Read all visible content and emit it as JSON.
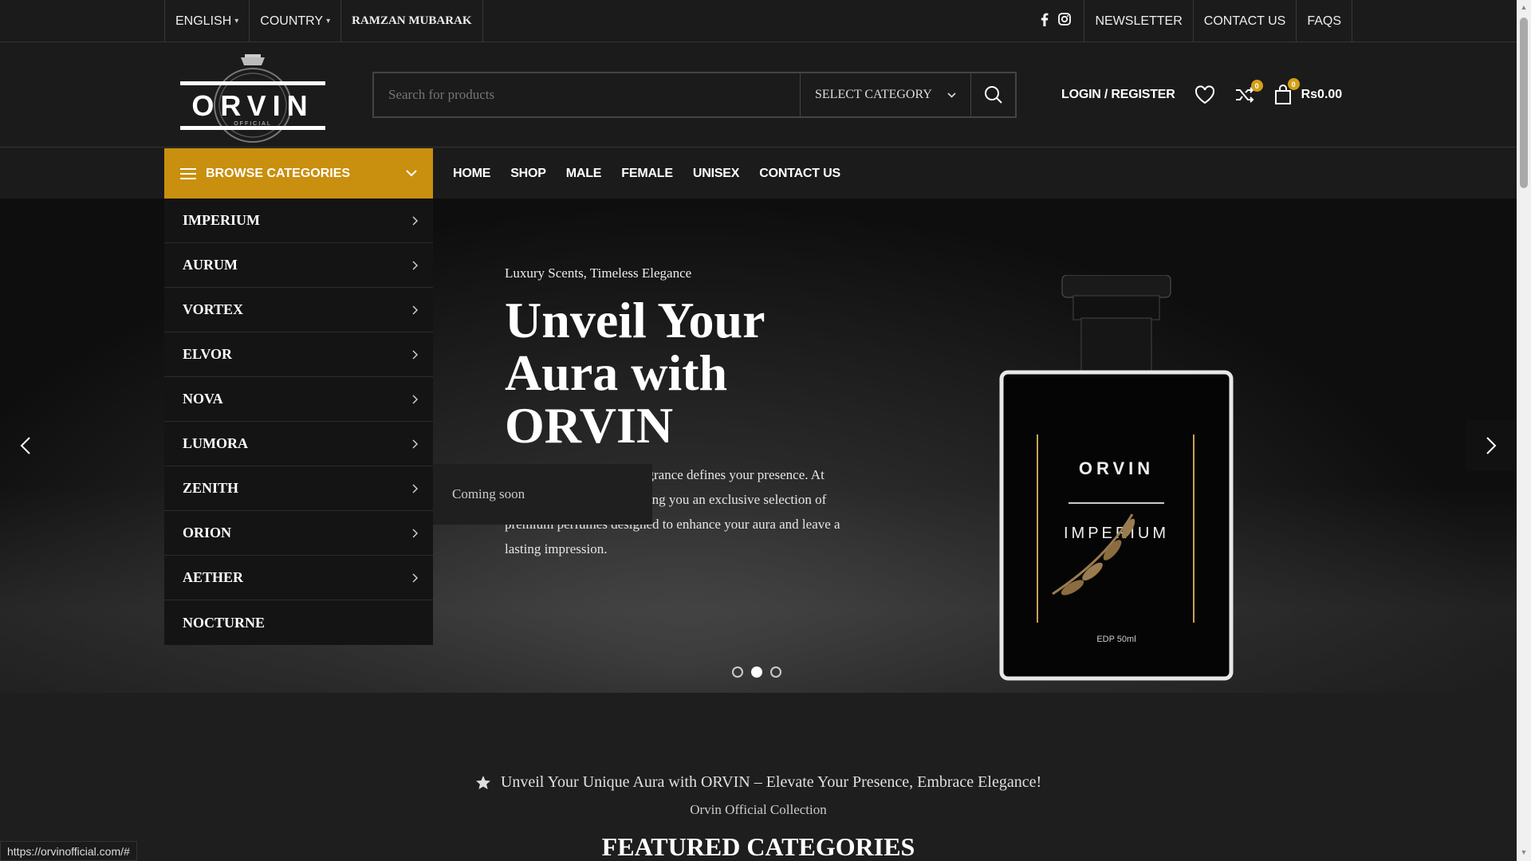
{
  "topbar": {
    "language": "ENGLISH",
    "country": "COUNTRY",
    "promo": "RAMZAN MUBARAK",
    "links": [
      "NEWSLETTER",
      "CONTACT US",
      "FAQS"
    ],
    "social_icons": [
      "facebook-icon",
      "instagram-icon"
    ]
  },
  "header": {
    "logo": {
      "brand": "ORVIN",
      "sub": "OFFICIAL"
    },
    "search": {
      "placeholder": "Search for products",
      "category": "SELECT CATEGORY"
    },
    "login": "LOGIN / REGISTER",
    "compare_count": "0",
    "cart_count": "0",
    "cart_total": "Rs0.00"
  },
  "nav": {
    "browse_label": "BROWSE CATEGORIES",
    "menu": [
      "HOME",
      "SHOP",
      "MALE",
      "FEMALE",
      "UNISEX",
      "CONTACT US"
    ]
  },
  "categories": [
    "IMPERIUM",
    "AURUM",
    "VORTEX",
    "ELVOR",
    "NOVA",
    "LUMORA",
    "ZENITH",
    "ORION",
    "AETHER",
    "NOCTURNE"
  ],
  "tooltip": "Coming soon",
  "hero": {
    "subtitle": "Luxury Scents, Timeless Elegance",
    "title": "Unveil Your Aura with ORVIN",
    "description": "At ORVIN, we believe fragrance defines your presence. At ORVIN OFFICIAL, we bring you an exclusive selection of premium perfumes designed to enhance your aura and leave a lasting impression.",
    "slides": 3,
    "active_slide": 2,
    "product": {
      "brand": "ORVIN",
      "name": "IMPERIUM",
      "size": "EDP 50ml"
    }
  },
  "section": {
    "tagline": "Unveil Your Unique Aura with ORVIN – Elevate Your Presence, Embrace Elegance!",
    "tagline_sub": "Orvin Official Collection",
    "featured_title": "FEATURED CATEGORIES"
  },
  "status_url": "https://orvinofficial.com/#",
  "colors": {
    "accent": "#c98f0e",
    "badge": "#d4a017",
    "background": "#1e1e1e"
  }
}
